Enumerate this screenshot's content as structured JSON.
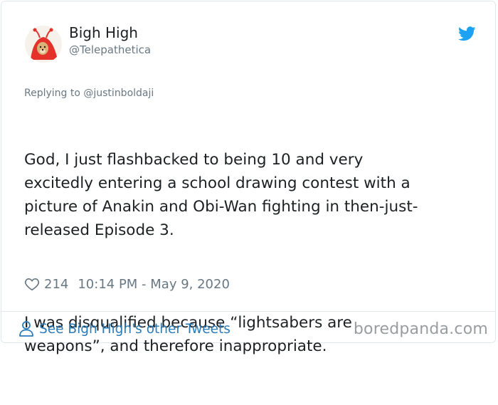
{
  "tweet": {
    "display_name": "Bigh High",
    "handle": "@Telepathetica",
    "replying_to": "Replying to @justinboldaji",
    "paragraphs": [
      "God, I just flashbacked to being 10 and very\nexcitedly entering a school drawing contest with a\npicture of Anakin and Obi-Wan fighting in then-just-\nreleased Episode 3.",
      "I was disqualified because “lightsabers are\nweapons”, and therefore inappropriate."
    ],
    "likes": "214",
    "timestamp": "10:14 PM - May 9, 2020"
  },
  "footer": {
    "see_other_tweets": "See Bigh High's other Tweets",
    "watermark": "boredpanda.com"
  },
  "icons": {
    "bird": "twitter-bird-icon",
    "heart": "heart-icon",
    "person": "person-icon"
  },
  "colors": {
    "twitter_blue": "#1da1f2",
    "link_blue": "#2b7bb9",
    "muted_text": "#697882",
    "primary_text": "#1c2022"
  }
}
